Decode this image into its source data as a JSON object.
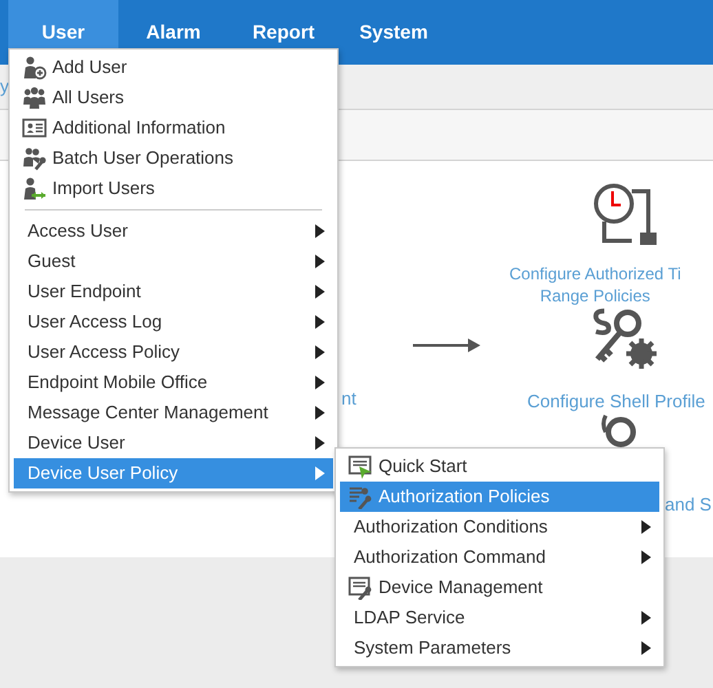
{
  "nav": {
    "tabs": [
      {
        "label": "User",
        "selected": true
      },
      {
        "label": "Alarm",
        "selected": false
      },
      {
        "label": "Report",
        "selected": false
      },
      {
        "label": "System",
        "selected": false
      }
    ]
  },
  "breadcrumb": {
    "link": "y"
  },
  "diagram": {
    "left_link": "nt",
    "steps": [
      {
        "label": "Configure Authorized Ti\nRange Policies"
      },
      {
        "label": "Configure Shell Profile"
      },
      {
        "label": "and S"
      }
    ]
  },
  "menu": {
    "items": [
      {
        "kind": "action",
        "label": "Add User",
        "selected": false
      },
      {
        "kind": "action",
        "label": "All Users",
        "selected": false
      },
      {
        "kind": "action",
        "label": "Additional Information",
        "selected": false
      },
      {
        "kind": "action",
        "label": "Batch User Operations",
        "selected": false
      },
      {
        "kind": "action",
        "label": "Import Users",
        "selected": false
      },
      {
        "kind": "submenu",
        "label": "Access User",
        "selected": false
      },
      {
        "kind": "submenu",
        "label": "Guest",
        "selected": false
      },
      {
        "kind": "submenu",
        "label": "User Endpoint",
        "selected": false
      },
      {
        "kind": "submenu",
        "label": "User Access Log",
        "selected": false
      },
      {
        "kind": "submenu",
        "label": "User Access Policy",
        "selected": false
      },
      {
        "kind": "submenu",
        "label": "Endpoint Mobile Office",
        "selected": false
      },
      {
        "kind": "submenu",
        "label": "Message Center Management",
        "selected": false
      },
      {
        "kind": "submenu",
        "label": "Device User",
        "selected": false
      },
      {
        "kind": "submenu",
        "label": "Device User Policy",
        "selected": true
      }
    ]
  },
  "submenu": {
    "items": [
      {
        "kind": "action",
        "label": "Quick Start",
        "selected": false
      },
      {
        "kind": "action",
        "label": "Authorization Policies",
        "selected": true
      },
      {
        "kind": "submenu",
        "label": "Authorization Conditions",
        "selected": false
      },
      {
        "kind": "submenu",
        "label": "Authorization Command",
        "selected": false
      },
      {
        "kind": "action",
        "label": "Device Management",
        "selected": false
      },
      {
        "kind": "submenu",
        "label": "LDAP Service",
        "selected": false
      },
      {
        "kind": "submenu",
        "label": "System Parameters",
        "selected": false
      }
    ]
  }
}
